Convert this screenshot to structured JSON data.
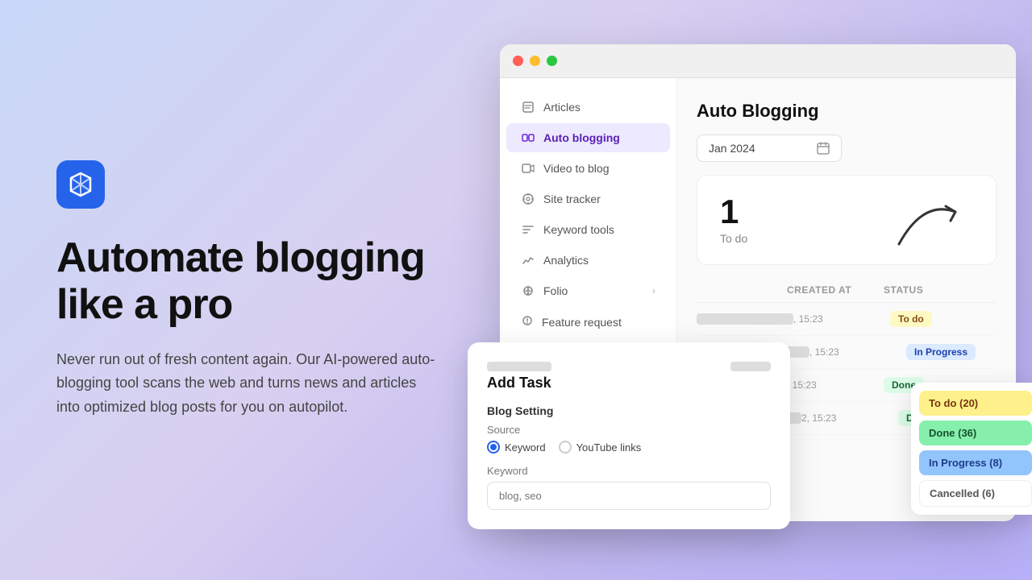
{
  "left": {
    "logo_alt": "Logo",
    "title_line1": "Automate blogging",
    "title_line2": "like a pro",
    "description": "Never run out of fresh content again. Our AI-powered auto-blogging tool scans the web and turns news and articles into optimized blog posts for you on autopilot."
  },
  "browser": {
    "window_controls": [
      "close",
      "minimize",
      "maximize"
    ],
    "sidebar": {
      "items": [
        {
          "id": "articles",
          "label": "Articles",
          "active": false
        },
        {
          "id": "auto-blogging",
          "label": "Auto blogging",
          "active": true
        },
        {
          "id": "video-to-blog",
          "label": "Video to blog",
          "active": false
        },
        {
          "id": "site-tracker",
          "label": "Site tracker",
          "active": false
        },
        {
          "id": "keyword-tools",
          "label": "Keyword tools",
          "active": false
        },
        {
          "id": "analytics",
          "label": "Analytics",
          "active": false
        },
        {
          "id": "folio",
          "label": "Folio",
          "active": false,
          "hasChevron": true
        }
      ]
    },
    "main": {
      "title": "Auto Blogging",
      "date_picker": "Jan 2024",
      "stat_number": "1",
      "stat_label": "To do",
      "table": {
        "headers": [
          "",
          "Created at",
          "Status",
          ""
        ],
        "rows": [
          {
            "name": "...",
            "created_at": ", 15:23",
            "status": "To do",
            "badge": "todo"
          },
          {
            "name": "...",
            "created_at": ", 15:23",
            "status": "In Progress",
            "badge": "inprogress"
          },
          {
            "name": "...",
            "created_at": ", 15:23",
            "status": "Done",
            "badge": "done"
          },
          {
            "name": "...",
            "created_at": "2, 15:23",
            "status": "Done",
            "badge": "done"
          }
        ]
      }
    },
    "add_task": {
      "title": "Add Task",
      "blog_setting_label": "Blog Setting",
      "source_label": "Source",
      "source_options": [
        {
          "label": "Keyword",
          "selected": true
        },
        {
          "label": "YouTube links",
          "selected": false
        }
      ],
      "keyword_label": "Keyword",
      "keyword_placeholder": "blog, seo"
    },
    "dropdown": {
      "items": [
        {
          "label": "To do (20)",
          "style": "todo"
        },
        {
          "label": "Done (36)",
          "style": "done"
        },
        {
          "label": "In Progress (8)",
          "style": "inprogress"
        },
        {
          "label": "Cancelled (6)",
          "style": "cancelled"
        }
      ]
    },
    "feature_request_label": "Feature request"
  }
}
